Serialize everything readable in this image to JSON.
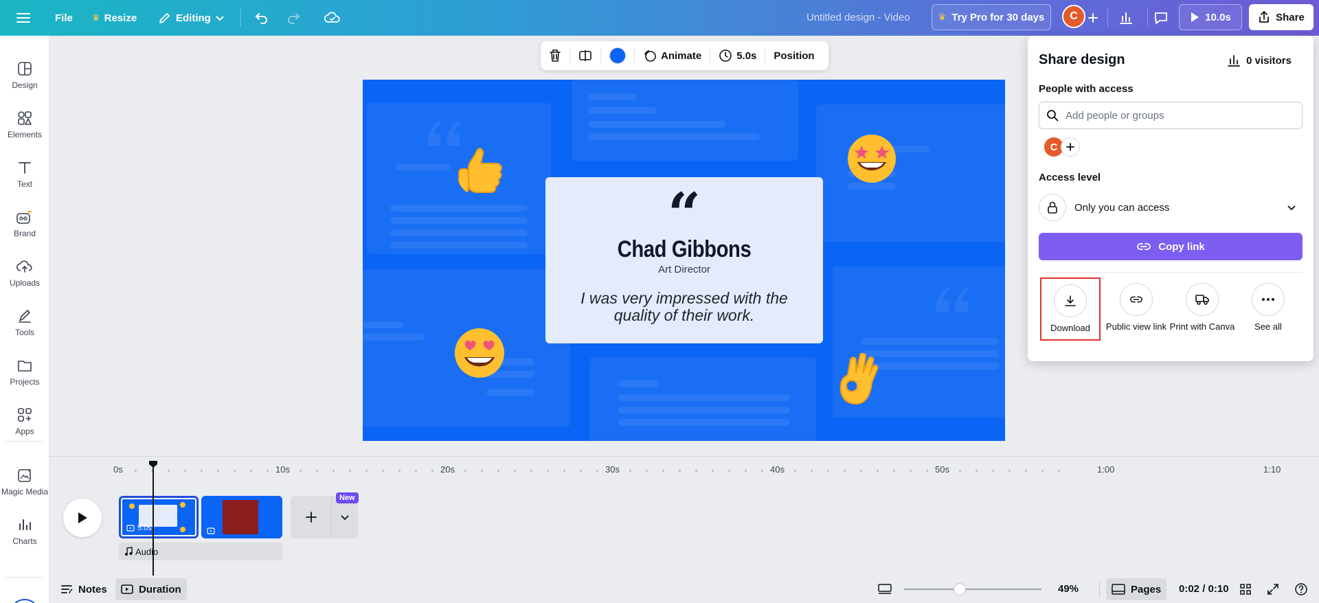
{
  "topbar": {
    "file": "File",
    "resize": "Resize",
    "editing": "Editing",
    "doc_title": "Untitled design - Video",
    "try_pro": "Try Pro for 30 days",
    "avatar_initial": "C",
    "play_duration": "10.0s",
    "share": "Share"
  },
  "sidebar": {
    "items": [
      {
        "label": "Design",
        "icon": "design-icon"
      },
      {
        "label": "Elements",
        "icon": "elements-icon"
      },
      {
        "label": "Text",
        "icon": "text-icon"
      },
      {
        "label": "Brand",
        "icon": "brand-icon"
      },
      {
        "label": "Uploads",
        "icon": "uploads-icon"
      },
      {
        "label": "Tools",
        "icon": "tools-icon"
      },
      {
        "label": "Projects",
        "icon": "projects-icon"
      },
      {
        "label": "Apps",
        "icon": "apps-icon"
      },
      {
        "label": "Magic Media",
        "icon": "magic-media-icon"
      },
      {
        "label": "Charts",
        "icon": "charts-icon"
      }
    ]
  },
  "context_toolbar": {
    "animate": "Animate",
    "duration": "5.0s",
    "position": "Position",
    "color": "#0a64f5"
  },
  "slide": {
    "quote_mark": "“",
    "name": "Chad Gibbons",
    "role": "Art Director",
    "quote": "I was very impressed with the quality of their work."
  },
  "share_panel": {
    "title": "Share design",
    "visitors": "0 visitors",
    "people_label": "People with access",
    "search_placeholder": "Add people or groups",
    "avatar_initial": "C",
    "access_label": "Access level",
    "access_value": "Only you can access",
    "copy_link": "Copy link",
    "options": [
      {
        "label": "Download",
        "icon": "download-icon"
      },
      {
        "label": "Public view link",
        "icon": "link-icon"
      },
      {
        "label": "Print with Canva",
        "icon": "truck-icon"
      },
      {
        "label": "See all",
        "icon": "more-icon"
      }
    ]
  },
  "timeline": {
    "ticks": [
      "0s",
      "10s",
      "20s",
      "30s",
      "40s",
      "50s",
      "1:00",
      "1:10"
    ],
    "clip1_duration": "5.0s",
    "new_badge": "New",
    "audio_label": "Audio"
  },
  "bottombar": {
    "notes": "Notes",
    "duration": "Duration",
    "zoom": "49%",
    "pages": "Pages",
    "time": "0:02 / 0:10"
  },
  "colors": {
    "accent": "#7d5ef1",
    "slide_bg": "#0a64f5",
    "highlight": "#e0312a"
  }
}
